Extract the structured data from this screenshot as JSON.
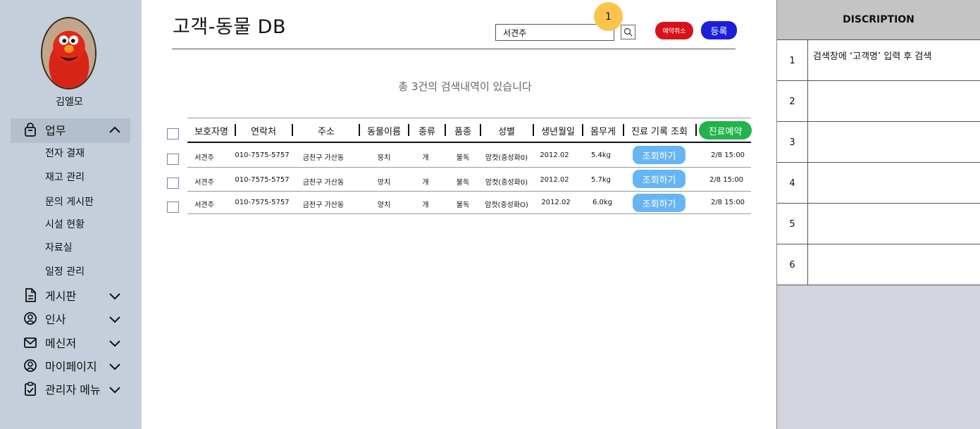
{
  "user": {
    "name": "김엘모"
  },
  "sidebar": {
    "section_work": {
      "label": "업무",
      "icon": "bag-icon"
    },
    "sub_items": [
      "전자 결재",
      "재고 관리",
      "문의 게시판",
      "시설 현황",
      "자료실",
      "일정 관리"
    ],
    "sections": [
      {
        "label": "게시판",
        "icon": "document-icon"
      },
      {
        "label": "인사",
        "icon": "user-circle-icon"
      },
      {
        "label": "메신저",
        "icon": "mail-icon"
      },
      {
        "label": "마이페이지",
        "icon": "user-circle-icon"
      },
      {
        "label": "관리자 메뉴",
        "icon": "clipboard-icon"
      }
    ]
  },
  "page": {
    "title": "고객-동물 DB"
  },
  "search": {
    "value": "서견주",
    "marker": "1"
  },
  "buttons": {
    "cancel_reservation": "예약취소",
    "register": "등록",
    "reserve": "진료예약",
    "view": "조회하기"
  },
  "result_count": "총 3건의 검색내역이 있습니다",
  "table": {
    "headers": [
      "보호자명",
      "연락처",
      "주소",
      "동물이름",
      "종류",
      "품종",
      "성별",
      "생년월일",
      "몸무게",
      "진료 기록 조회"
    ],
    "rows": [
      [
        "서견주",
        "010-7575-5757",
        "금천구 가산동",
        "뭉치",
        "개",
        "불독",
        "암컷(중성화0)",
        "2012.02",
        "5.4kg",
        "2/8  15:00"
      ],
      [
        "서견주",
        "010-7575-5757",
        "금천구 가산동",
        "망치",
        "개",
        "불독",
        "암컷(중성화0)",
        "2012.02",
        "5.7kg",
        "2/8  15:00"
      ],
      [
        "서견주",
        "010-7575-5757",
        "금천구 가산동",
        "양치",
        "개",
        "불독",
        "암컷(중성화O)",
        "2012.02",
        "6.0kg",
        "2/8  15:00"
      ]
    ]
  },
  "description": {
    "header": "DISCRIPTION",
    "rows": [
      {
        "num": "1",
        "text": "검색창에 ‘고객명’ 입력 후 검색"
      },
      {
        "num": "2",
        "text": ""
      },
      {
        "num": "3",
        "text": ""
      },
      {
        "num": "4",
        "text": ""
      },
      {
        "num": "5",
        "text": ""
      },
      {
        "num": "6",
        "text": ""
      }
    ]
  },
  "colors": {
    "sidebar_bg": "#c5cfdb",
    "cancel": "#d8121b",
    "register": "#1d1ed9",
    "reserve": "#22b34c",
    "view": "#66b5f4",
    "marker": "#fdc34d"
  }
}
